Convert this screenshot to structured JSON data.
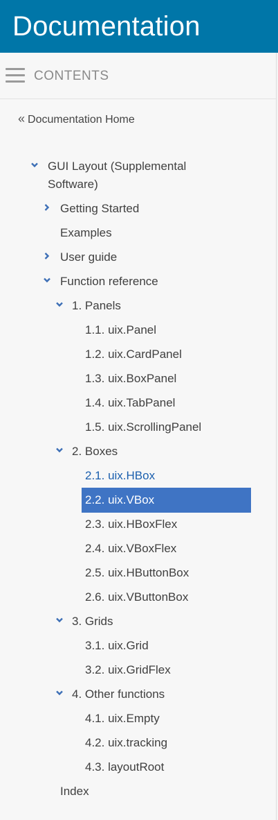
{
  "header": {
    "title": "Documentation"
  },
  "contents": {
    "label": "CONTENTS",
    "menu_icon": "hamburger-menu-icon"
  },
  "home": {
    "prefix": "«",
    "label": "Documentation Home"
  },
  "tree": {
    "root": {
      "label": "GUI Layout (Supplemental Software)"
    },
    "getting_started": "Getting Started",
    "examples": "Examples",
    "user_guide": "User guide",
    "function_reference": "Function reference",
    "panels": {
      "label": "1. Panels",
      "items": [
        "1.1. uix.Panel",
        "1.2. uix.CardPanel",
        "1.3. uix.BoxPanel",
        "1.4. uix.TabPanel",
        "1.5. uix.ScrollingPanel"
      ]
    },
    "boxes": {
      "label": "2. Boxes",
      "items": [
        "2.1. uix.HBox",
        "2.2. uix.VBox",
        "2.3. uix.HBoxFlex",
        "2.4. uix.VBoxFlex",
        "2.5. uix.HButtonBox",
        "2.6. uix.VButtonBox"
      ]
    },
    "grids": {
      "label": "3. Grids",
      "items": [
        "3.1. uix.Grid",
        "3.2. uix.GridFlex"
      ]
    },
    "other": {
      "label": "4. Other functions",
      "items": [
        "4.1. uix.Empty",
        "4.2. uix.tracking",
        "4.3. layoutRoot"
      ]
    },
    "index": "Index"
  },
  "colors": {
    "header_bg": "#0076a8",
    "selected_bg": "#3f74c4",
    "link_active": "#1b5fae",
    "chevron": "#3d6fb6"
  }
}
